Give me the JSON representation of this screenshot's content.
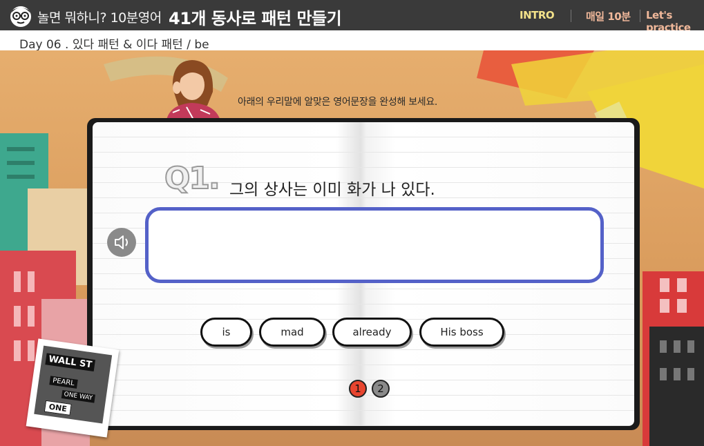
{
  "header": {
    "series": "놀면 뭐하니? 10분영어",
    "course": "41개 동사로 패턴 만들기",
    "nav": [
      "INTRO",
      "매일 10분",
      "Let's practice"
    ]
  },
  "subheader": {
    "title": "Day 06 . 있다 패턴 & 이다 패턴 / be"
  },
  "instruction": "아래의 우리말에 알맞은 영어문장을 완성해 보세요.",
  "question": {
    "number": "Q1.",
    "korean": "그의 상사는 이미 화가 나 있다.",
    "answer_value": ""
  },
  "word_choices": [
    "is",
    "mad",
    "already",
    "His boss"
  ],
  "pages": [
    "1",
    "2"
  ],
  "scenery": {
    "sign_lines": [
      "WALL ST",
      "PEARL",
      "ONE WAY",
      "ONE"
    ]
  },
  "colors": {
    "topbar": "#3a3a3a",
    "accent_blue": "#5461c8",
    "page_active": "#e8452f"
  }
}
